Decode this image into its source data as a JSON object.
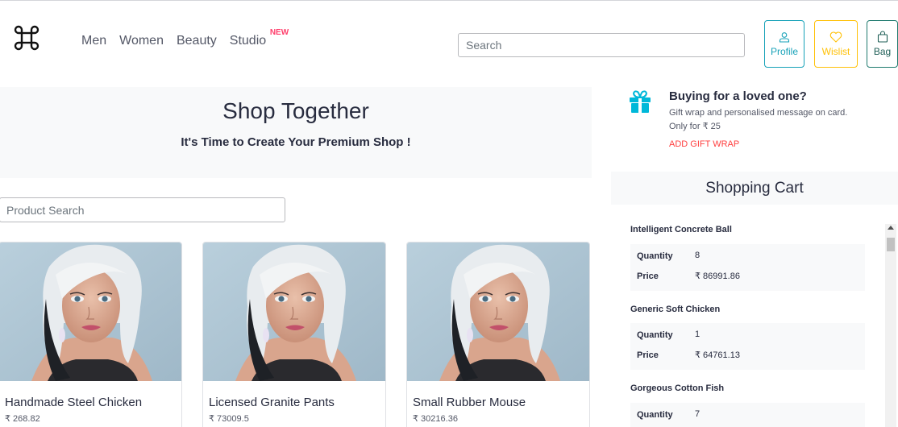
{
  "header": {
    "logo_icon": "command-key-icon",
    "nav": [
      {
        "label": "Men"
      },
      {
        "label": "Women"
      },
      {
        "label": "Beauty"
      },
      {
        "label": "Studio",
        "badge": "NEW"
      }
    ],
    "search_placeholder": "Search",
    "actions": [
      {
        "label": "Profile",
        "icon": "user-icon",
        "color": "#17a2b8"
      },
      {
        "label": "Wislist",
        "icon": "heart-icon",
        "color": "#ffc107"
      },
      {
        "label": "Bag",
        "icon": "bag-icon",
        "color": "#1f7a6e"
      }
    ]
  },
  "hero": {
    "title": "Shop Together",
    "subtitle": "It's Time to Create Your Premium Shop !"
  },
  "product_search_placeholder": "Product Search",
  "products": [
    {
      "name": "Handmade Steel Chicken",
      "price": "₹ 268.82"
    },
    {
      "name": "Licensed Granite Pants",
      "price": "₹ 73009.5"
    },
    {
      "name": "Small Rubber Mouse",
      "price": "₹ 30216.36"
    }
  ],
  "gift": {
    "icon": "gift-icon",
    "title": "Buying for a loved one?",
    "line1": "Gift wrap and personalised message on card.",
    "line2": "Only for ₹ 25",
    "link": "ADD GIFT WRAP",
    "accent": "#00b8d9"
  },
  "cart": {
    "title": "Shopping Cart",
    "quantity_label": "Quantity",
    "price_label": "Price",
    "items": [
      {
        "name": "Intelligent Concrete Ball",
        "quantity": "8",
        "price": "₹ 86991.86"
      },
      {
        "name": "Generic Soft Chicken",
        "quantity": "1",
        "price": "₹ 64761.13"
      },
      {
        "name": "Gorgeous Cotton Fish",
        "quantity": "7",
        "price": ""
      }
    ]
  }
}
